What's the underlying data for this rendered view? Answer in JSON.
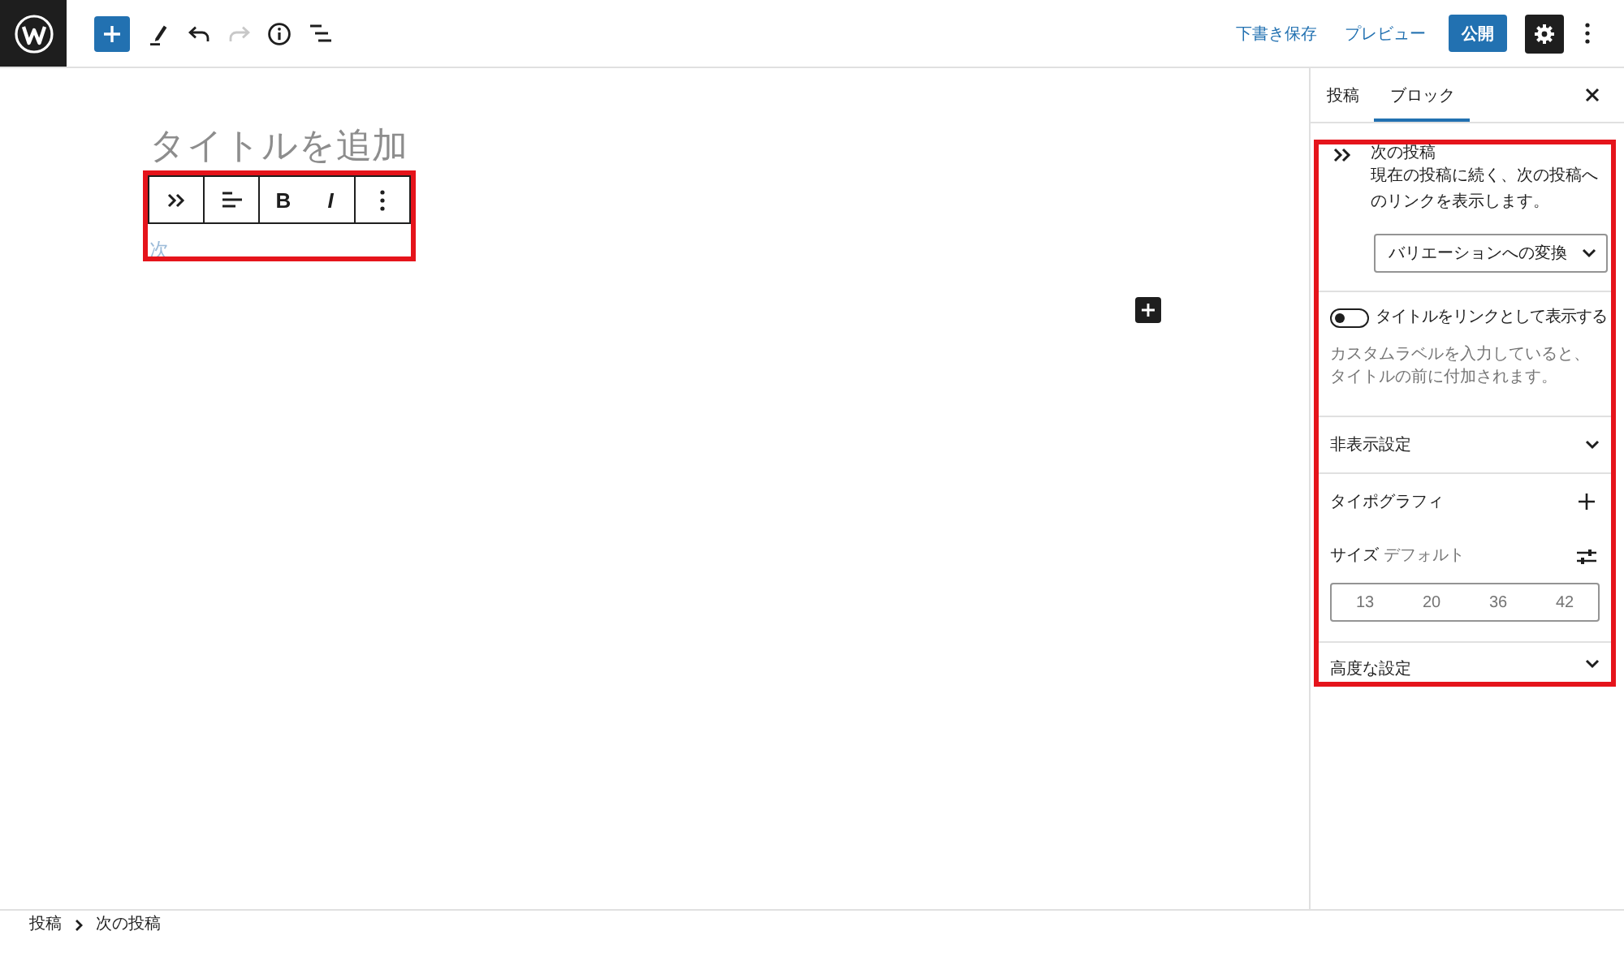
{
  "top_bar": {
    "tools": [
      {
        "kind": "add",
        "disabled": false
      },
      {
        "kind": "edit",
        "disabled": false
      },
      {
        "kind": "undo",
        "disabled": false
      },
      {
        "kind": "redo",
        "disabled": true
      },
      {
        "kind": "info",
        "disabled": false
      },
      {
        "kind": "list",
        "disabled": false
      }
    ],
    "save_draft": "下書き保存",
    "preview": "プレビュー",
    "publish": "公開",
    "settings": {
      "pressed": true
    }
  },
  "editor": {
    "title": {
      "placeholder": "タイトルを追加"
    },
    "block_toolbar": {
      "highlighted": true,
      "groups": [
        [
          {
            "kind": "transform"
          }
        ],
        [
          {
            "kind": "align"
          }
        ],
        [
          {
            "kind": "bold",
            "label": "B"
          },
          {
            "kind": "italic",
            "label": "I"
          }
        ],
        [
          {
            "kind": "more"
          }
        ]
      ]
    },
    "block_text": "次"
  },
  "sidebar": {
    "tabs": [
      {
        "label": "投稿",
        "selected": false
      },
      {
        "label": "ブロック",
        "selected": true
      }
    ],
    "highlighted": true,
    "block_card": {
      "title": "次の投稿",
      "description": "現在の投稿に続く、次の投稿へのリンクを表示します。"
    },
    "variation_select": {
      "value": "バリエーションへの変換"
    },
    "link_toggle": {
      "label": "タイトルをリンクとして表示する",
      "on": false,
      "help": "カスタムラベルを入力していると、タイトルの前に付加されます。"
    },
    "panels": [
      {
        "kind": "collapsible",
        "title": "非表示設定",
        "expanded": false
      },
      {
        "kind": "typography",
        "title": "タイポグラフィ",
        "size_label": "サイズ",
        "size_value": "デフォルト",
        "sizes": [
          {
            "label": "13",
            "selected": false
          },
          {
            "label": "20",
            "selected": false
          },
          {
            "label": "36",
            "selected": false
          },
          {
            "label": "42",
            "selected": false
          }
        ]
      },
      {
        "kind": "collapsible",
        "title": "高度な設定",
        "expanded": false
      }
    ]
  },
  "breadcrumb": [
    {
      "label": "投稿"
    },
    {
      "label": "次の投稿"
    }
  ]
}
